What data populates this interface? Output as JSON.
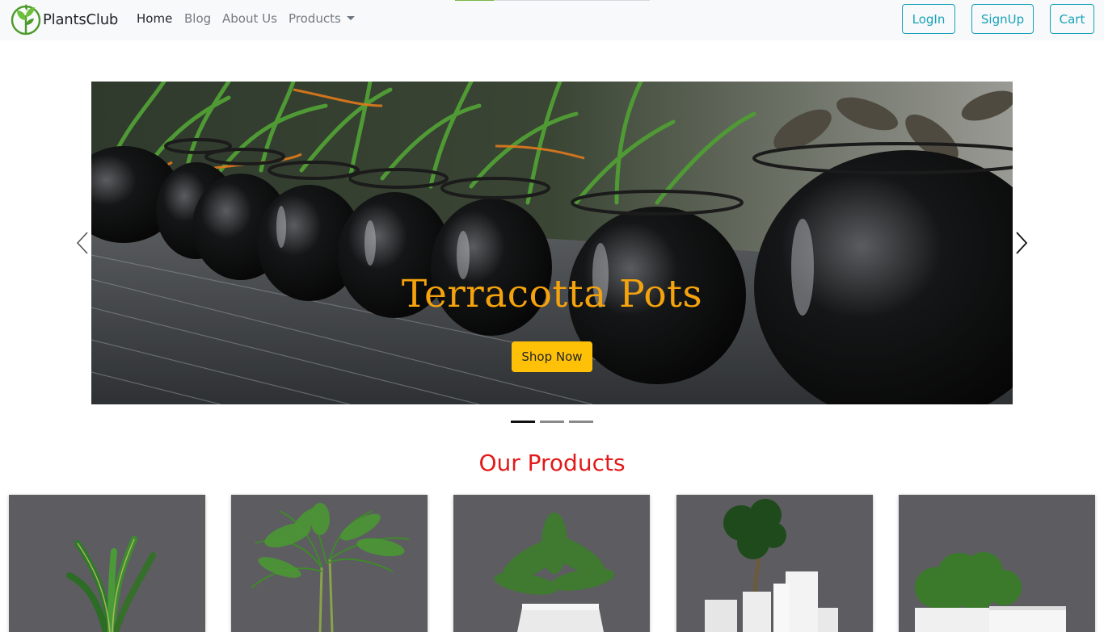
{
  "navbar": {
    "brand": "PlantsClub",
    "links": [
      {
        "label": "Home",
        "active": true
      },
      {
        "label": "Blog",
        "active": false
      },
      {
        "label": "About Us",
        "active": false
      },
      {
        "label": "Products",
        "active": false,
        "dropdown": true
      }
    ],
    "buttons": [
      "LogIn",
      "SignUp",
      "Cart"
    ],
    "accent_color": "#17a2b8"
  },
  "carousel": {
    "slide_title": "Terracotta Pots",
    "cta_label": "Shop Now",
    "indicator_count": 3,
    "active_indicator": 0,
    "title_color": "#f5a30d",
    "cta_color": "#ffc107",
    "prev_icon": "chevron-left-icon",
    "next_icon": "chevron-right-icon"
  },
  "products": {
    "heading": "Our Products",
    "heading_color": "#e21a1a",
    "cards": [
      {
        "image": "snake-plant-image"
      },
      {
        "image": "areca-palm-image"
      },
      {
        "image": "bird-nest-fern-image"
      },
      {
        "image": "bonsai-tree-image"
      },
      {
        "image": "boxwood-shrub-image"
      }
    ]
  }
}
